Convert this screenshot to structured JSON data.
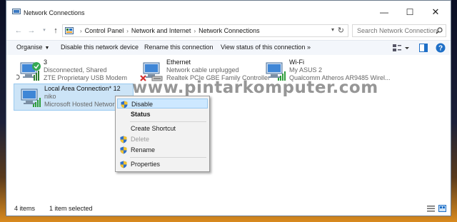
{
  "window": {
    "title": "Network Connections"
  },
  "titlebar": {
    "minimize": "—",
    "maximize": "☐",
    "close": "✕"
  },
  "nav": {
    "back": "←",
    "forward": "→",
    "recent": "▾",
    "up": "↑"
  },
  "address": {
    "crumbs": [
      "Control Panel",
      "Network and Internet",
      "Network Connections"
    ],
    "separator": "›",
    "dropdown": "▾",
    "refresh": "↻"
  },
  "search": {
    "placeholder": "Search Network Connections"
  },
  "commands": {
    "organise": "Organise",
    "organise_caret": "▼",
    "disable": "Disable this network device",
    "rename": "Rename this connection",
    "view_status": "View status of this connection",
    "more": "»"
  },
  "connections": [
    {
      "name": "3",
      "status": "Disconnected, Shared",
      "device": "ZTE Proprietary USB Modem",
      "icon": "network-adapter-connected-icon"
    },
    {
      "name": "Ethernet",
      "status": "Network cable unplugged",
      "device": "Realtek PCIe GBE Family Controller",
      "icon": "network-adapter-unplugged-icon"
    },
    {
      "name": "Wi-Fi",
      "status": "My ASUS  2",
      "device": "Qualcomm Atheros AR9485 Wirel...",
      "icon": "wifi-adapter-icon"
    },
    {
      "name": "Local Area Connection* 12",
      "status": "niko",
      "device": "Microsoft Hosted Network V...",
      "icon": "hosted-network-adapter-icon"
    }
  ],
  "watermark": "www.pintarkomputer.com",
  "context_menu": {
    "items": [
      {
        "label": "Disable",
        "shield": true,
        "state": "hover"
      },
      {
        "label": "Status",
        "shield": false,
        "state": "bold"
      },
      {
        "label": "Create Shortcut",
        "shield": false,
        "state": "normal"
      },
      {
        "label": "Delete",
        "shield": true,
        "state": "disabled"
      },
      {
        "label": "Rename",
        "shield": true,
        "state": "normal"
      },
      {
        "label": "Properties",
        "shield": true,
        "state": "normal"
      }
    ]
  },
  "status": {
    "count": "4 items",
    "selected": "1 item selected"
  },
  "colors": {
    "accent": "#0078d7",
    "selection": "#cce4f7",
    "selection_border": "#99c9ef",
    "menu_bg": "#f2f2f2"
  }
}
